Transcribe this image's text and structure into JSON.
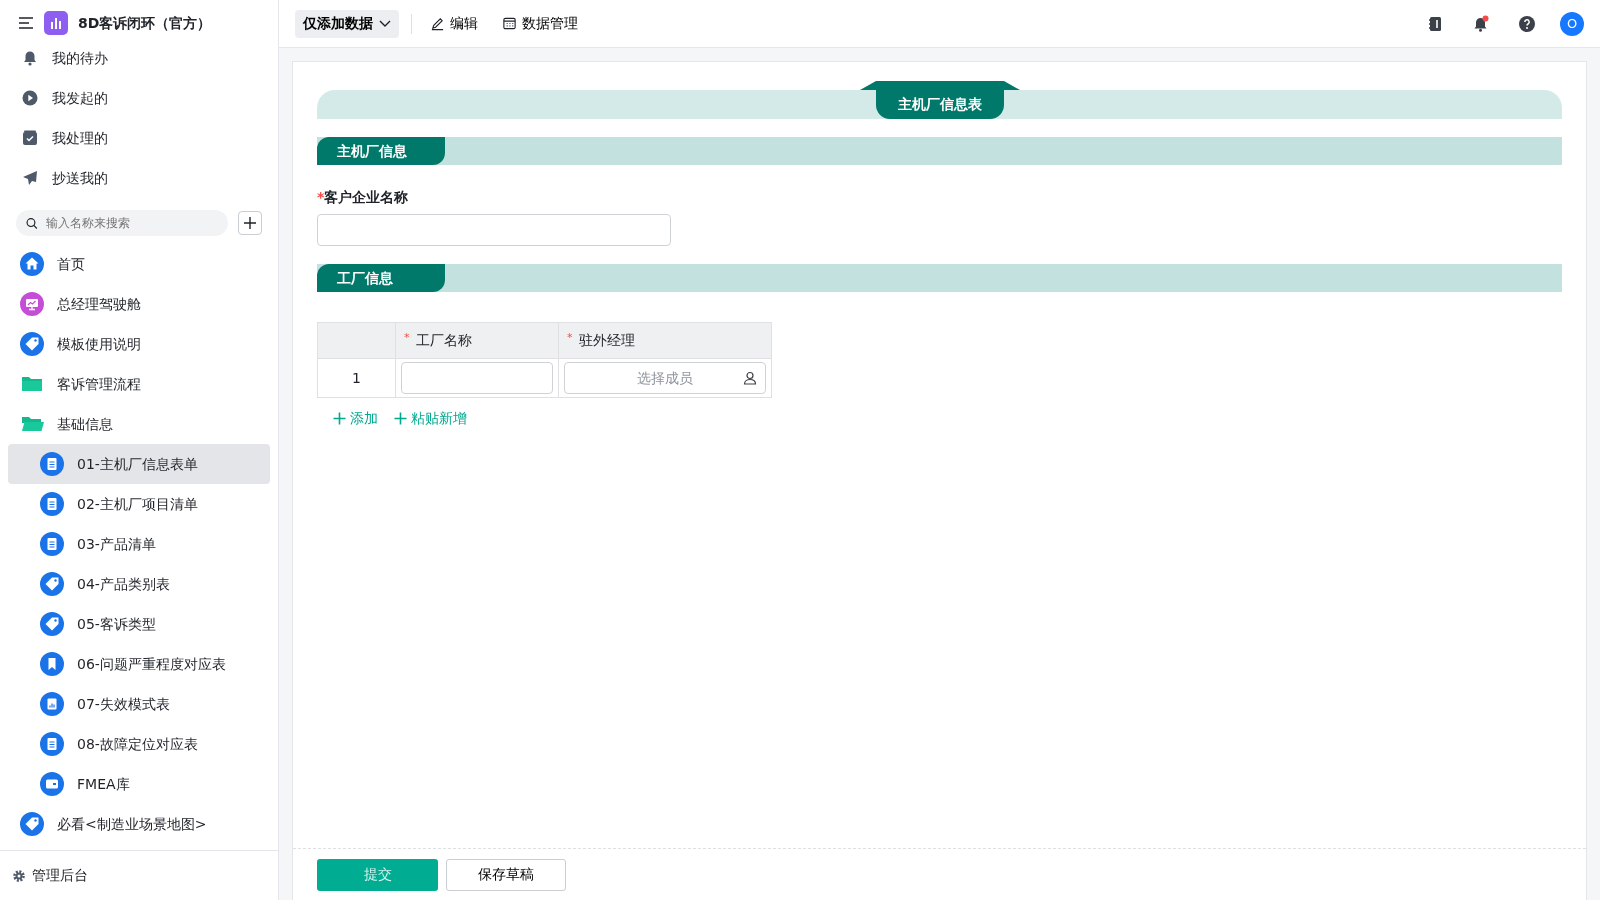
{
  "app": {
    "title": "8D客诉闭环（官方）"
  },
  "quick_nav": [
    {
      "label": "我的待办",
      "kind": "bell"
    },
    {
      "label": "我发起的",
      "kind": "play"
    },
    {
      "label": "我处理的",
      "kind": "inbox"
    },
    {
      "label": "抄送我的",
      "kind": "send"
    }
  ],
  "search": {
    "placeholder": "输入名称来搜索"
  },
  "nav": [
    {
      "label": "首页",
      "kind": "home",
      "selected": false
    },
    {
      "label": "总经理驾驶舱",
      "kind": "dashboard",
      "selected": false
    },
    {
      "label": "模板使用说明",
      "kind": "tag",
      "selected": false
    },
    {
      "label": "客诉管理流程",
      "kind": "folder",
      "selected": false
    },
    {
      "label": "基础信息",
      "kind": "folder-open",
      "selected": false,
      "children": [
        {
          "label": "01-主机厂信息表单",
          "kind": "doc",
          "selected": true
        },
        {
          "label": "02-主机厂项目清单",
          "kind": "doc",
          "selected": false
        },
        {
          "label": "03-产品清单",
          "kind": "doc",
          "selected": false
        },
        {
          "label": "04-产品类别表",
          "kind": "tag",
          "selected": false
        },
        {
          "label": "05-客诉类型",
          "kind": "tag",
          "selected": false
        },
        {
          "label": "06-问题严重程度对应表",
          "kind": "bookmark",
          "selected": false
        },
        {
          "label": "07-失效模式表",
          "kind": "chart",
          "selected": false
        },
        {
          "label": "08-故障定位对应表",
          "kind": "doc",
          "selected": false
        },
        {
          "label": "FMEA库",
          "kind": "card",
          "selected": false
        }
      ]
    },
    {
      "label": "必看<制造业场景地图>",
      "kind": "tag",
      "selected": false
    }
  ],
  "admin": {
    "label": "管理后台"
  },
  "toolbar": {
    "mode": "仅添加数据",
    "actions": [
      {
        "label": "编辑",
        "kind": "pen"
      },
      {
        "label": "数据管理",
        "kind": "table"
      }
    ]
  },
  "user": {
    "initial": "O"
  },
  "form": {
    "title": "主机厂信息表",
    "sections": [
      {
        "title": "主机厂信息",
        "fields": [
          {
            "label": "客户企业名称",
            "required_mark": "*"
          }
        ]
      },
      {
        "title": "工厂信息",
        "table": {
          "columns": [
            {
              "label": "工厂名称",
              "required_mark": "*"
            },
            {
              "label": "驻外经理",
              "required_mark": "*"
            }
          ],
          "rows": [
            {
              "index": "1",
              "cells": [
                {
                  "kind": "text"
                },
                {
                  "kind": "member",
                  "placeholder": "选择成员"
                }
              ]
            }
          ],
          "actions": [
            "添加",
            "粘贴新增"
          ]
        }
      }
    ]
  },
  "footer": {
    "submit": "提交",
    "draft": "保存草稿"
  }
}
